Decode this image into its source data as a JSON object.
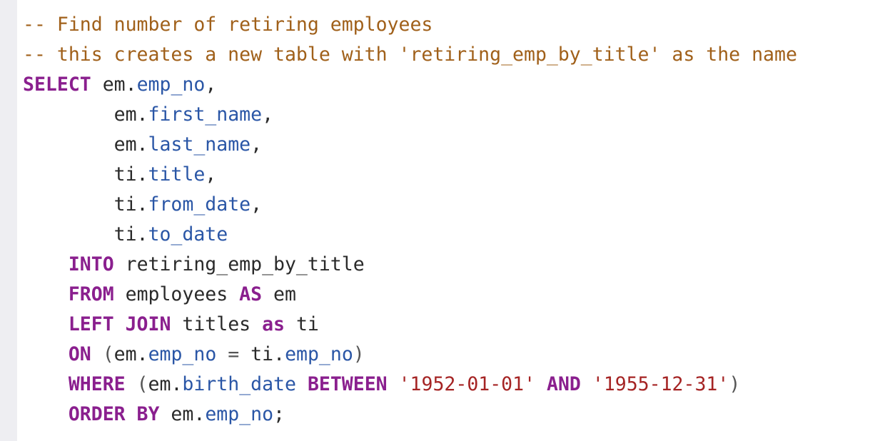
{
  "editor": {
    "language": "sql",
    "colors": {
      "comment": "#a0601a",
      "keyword": "#8a1f8e",
      "property": "#2a56a6",
      "string": "#a52424",
      "text": "#2a2a2a",
      "gutter": "#eeeef2"
    },
    "lines": [
      {
        "tokens": [
          {
            "t": "com",
            "v": "-- Find number of retiring employees"
          }
        ]
      },
      {
        "tokens": [
          {
            "t": "com",
            "v": "-- this creates a new table with 'retiring_emp_by_title' as the name"
          }
        ]
      },
      {
        "tokens": [
          {
            "t": "kw",
            "v": "SELECT"
          },
          {
            "t": "txt",
            "v": " em"
          },
          {
            "t": "txt",
            "v": "."
          },
          {
            "t": "prop",
            "v": "emp_no"
          },
          {
            "t": "txt",
            "v": ","
          }
        ]
      },
      {
        "tokens": [
          {
            "t": "txt",
            "v": "        em"
          },
          {
            "t": "txt",
            "v": "."
          },
          {
            "t": "prop",
            "v": "first_name"
          },
          {
            "t": "txt",
            "v": ","
          }
        ]
      },
      {
        "tokens": [
          {
            "t": "txt",
            "v": "        em"
          },
          {
            "t": "txt",
            "v": "."
          },
          {
            "t": "prop",
            "v": "last_name"
          },
          {
            "t": "txt",
            "v": ","
          }
        ]
      },
      {
        "tokens": [
          {
            "t": "txt",
            "v": "        ti"
          },
          {
            "t": "txt",
            "v": "."
          },
          {
            "t": "prop",
            "v": "title"
          },
          {
            "t": "txt",
            "v": ","
          }
        ]
      },
      {
        "tokens": [
          {
            "t": "txt",
            "v": "        ti"
          },
          {
            "t": "txt",
            "v": "."
          },
          {
            "t": "prop",
            "v": "from_date"
          },
          {
            "t": "txt",
            "v": ","
          }
        ]
      },
      {
        "tokens": [
          {
            "t": "txt",
            "v": "        ti"
          },
          {
            "t": "txt",
            "v": "."
          },
          {
            "t": "prop",
            "v": "to_date"
          }
        ]
      },
      {
        "tokens": [
          {
            "t": "txt",
            "v": "    "
          },
          {
            "t": "kw",
            "v": "INTO"
          },
          {
            "t": "txt",
            "v": " retiring_emp_by_title"
          }
        ]
      },
      {
        "tokens": [
          {
            "t": "txt",
            "v": "    "
          },
          {
            "t": "kw",
            "v": "FROM"
          },
          {
            "t": "txt",
            "v": " employees "
          },
          {
            "t": "kw",
            "v": "AS"
          },
          {
            "t": "txt",
            "v": " em"
          }
        ]
      },
      {
        "tokens": [
          {
            "t": "txt",
            "v": "    "
          },
          {
            "t": "kw",
            "v": "LEFT JOIN"
          },
          {
            "t": "txt",
            "v": " titles "
          },
          {
            "t": "kw",
            "v": "as"
          },
          {
            "t": "txt",
            "v": " ti"
          }
        ]
      },
      {
        "tokens": [
          {
            "t": "txt",
            "v": "    "
          },
          {
            "t": "kw",
            "v": "ON"
          },
          {
            "t": "pun",
            "v": " ("
          },
          {
            "t": "txt",
            "v": "em"
          },
          {
            "t": "txt",
            "v": "."
          },
          {
            "t": "prop",
            "v": "emp_no"
          },
          {
            "t": "pun",
            "v": " = "
          },
          {
            "t": "txt",
            "v": "ti"
          },
          {
            "t": "txt",
            "v": "."
          },
          {
            "t": "prop",
            "v": "emp_no"
          },
          {
            "t": "pun",
            "v": ")"
          }
        ]
      },
      {
        "tokens": [
          {
            "t": "txt",
            "v": "    "
          },
          {
            "t": "kw",
            "v": "WHERE"
          },
          {
            "t": "pun",
            "v": " ("
          },
          {
            "t": "txt",
            "v": "em"
          },
          {
            "t": "txt",
            "v": "."
          },
          {
            "t": "prop",
            "v": "birth_date"
          },
          {
            "t": "txt",
            "v": " "
          },
          {
            "t": "kw",
            "v": "BETWEEN"
          },
          {
            "t": "txt",
            "v": " "
          },
          {
            "t": "str",
            "v": "'1952-01-01'"
          },
          {
            "t": "txt",
            "v": " "
          },
          {
            "t": "kw",
            "v": "AND"
          },
          {
            "t": "txt",
            "v": " "
          },
          {
            "t": "str",
            "v": "'1955-12-31'"
          },
          {
            "t": "pun",
            "v": ")"
          }
        ]
      },
      {
        "tokens": [
          {
            "t": "txt",
            "v": "    "
          },
          {
            "t": "kw",
            "v": "ORDER BY"
          },
          {
            "t": "txt",
            "v": " em"
          },
          {
            "t": "txt",
            "v": "."
          },
          {
            "t": "prop",
            "v": "emp_no"
          },
          {
            "t": "txt",
            "v": ";"
          }
        ]
      }
    ]
  }
}
